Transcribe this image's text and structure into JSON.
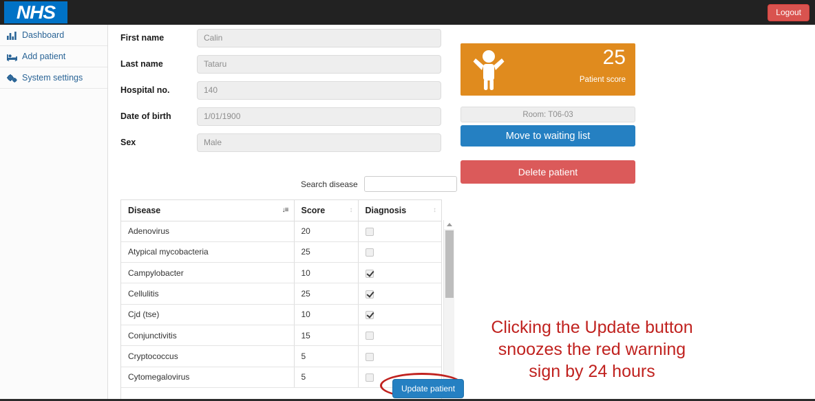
{
  "navbar": {
    "brand": "NHS",
    "logout_label": "Logout",
    "background": "#222222",
    "brand_background": "#0072c6",
    "logout_color": "#d9534f"
  },
  "sidebar": {
    "items": [
      {
        "label": "Dashboard",
        "icon": "bar-chart-icon"
      },
      {
        "label": "Add patient",
        "icon": "bed-icon"
      },
      {
        "label": "System settings",
        "icon": "cogs-icon"
      }
    ]
  },
  "patient_form": {
    "fields": [
      {
        "label": "First name",
        "value": "Calin"
      },
      {
        "label": "Last name",
        "value": "Tataru"
      },
      {
        "label": "Hospital no.",
        "value": "140"
      },
      {
        "label": "Date of birth",
        "value": "1/01/1900"
      },
      {
        "label": "Sex",
        "value": "Male"
      }
    ]
  },
  "score_card": {
    "value": "25",
    "label": "Patient score",
    "color": "#e08b1e",
    "icon": "child-icon"
  },
  "actions": {
    "room_label": "Room: T06-03",
    "move_to_waiting_label": "Move to waiting list",
    "move_to_waiting_color": "#2580c2",
    "delete_patient_label": "Delete patient",
    "delete_patient_color": "#db5a5a",
    "update_patient_label": "Update patient"
  },
  "search": {
    "label": "Search disease",
    "value": "",
    "placeholder": ""
  },
  "disease_table": {
    "columns": [
      {
        "label": "Disease",
        "sort": "asc"
      },
      {
        "label": "Score",
        "sort": "none"
      },
      {
        "label": "Diagnosis",
        "sort": "none"
      }
    ],
    "sort_glyph_active": "↓≡",
    "sort_glyph_idle": "↕",
    "rows": [
      {
        "disease": "Adenovirus",
        "score": "20",
        "diagnosed": false
      },
      {
        "disease": "Atypical mycobacteria",
        "score": "25",
        "diagnosed": false
      },
      {
        "disease": "Campylobacter",
        "score": "10",
        "diagnosed": true
      },
      {
        "disease": "Cellulitis",
        "score": "25",
        "diagnosed": true
      },
      {
        "disease": "Cjd (tse)",
        "score": "10",
        "diagnosed": true
      },
      {
        "disease": "Conjunctivitis",
        "score": "15",
        "diagnosed": false
      },
      {
        "disease": "Cryptococcus",
        "score": "5",
        "diagnosed": false
      },
      {
        "disease": "Cytomegalovirus",
        "score": "5",
        "diagnosed": false
      }
    ]
  },
  "annotation": {
    "line1": "Clicking the Update button",
    "line2": "snoozes the red warning",
    "line3": "sign by 24 hours",
    "color": "#c0221f"
  }
}
